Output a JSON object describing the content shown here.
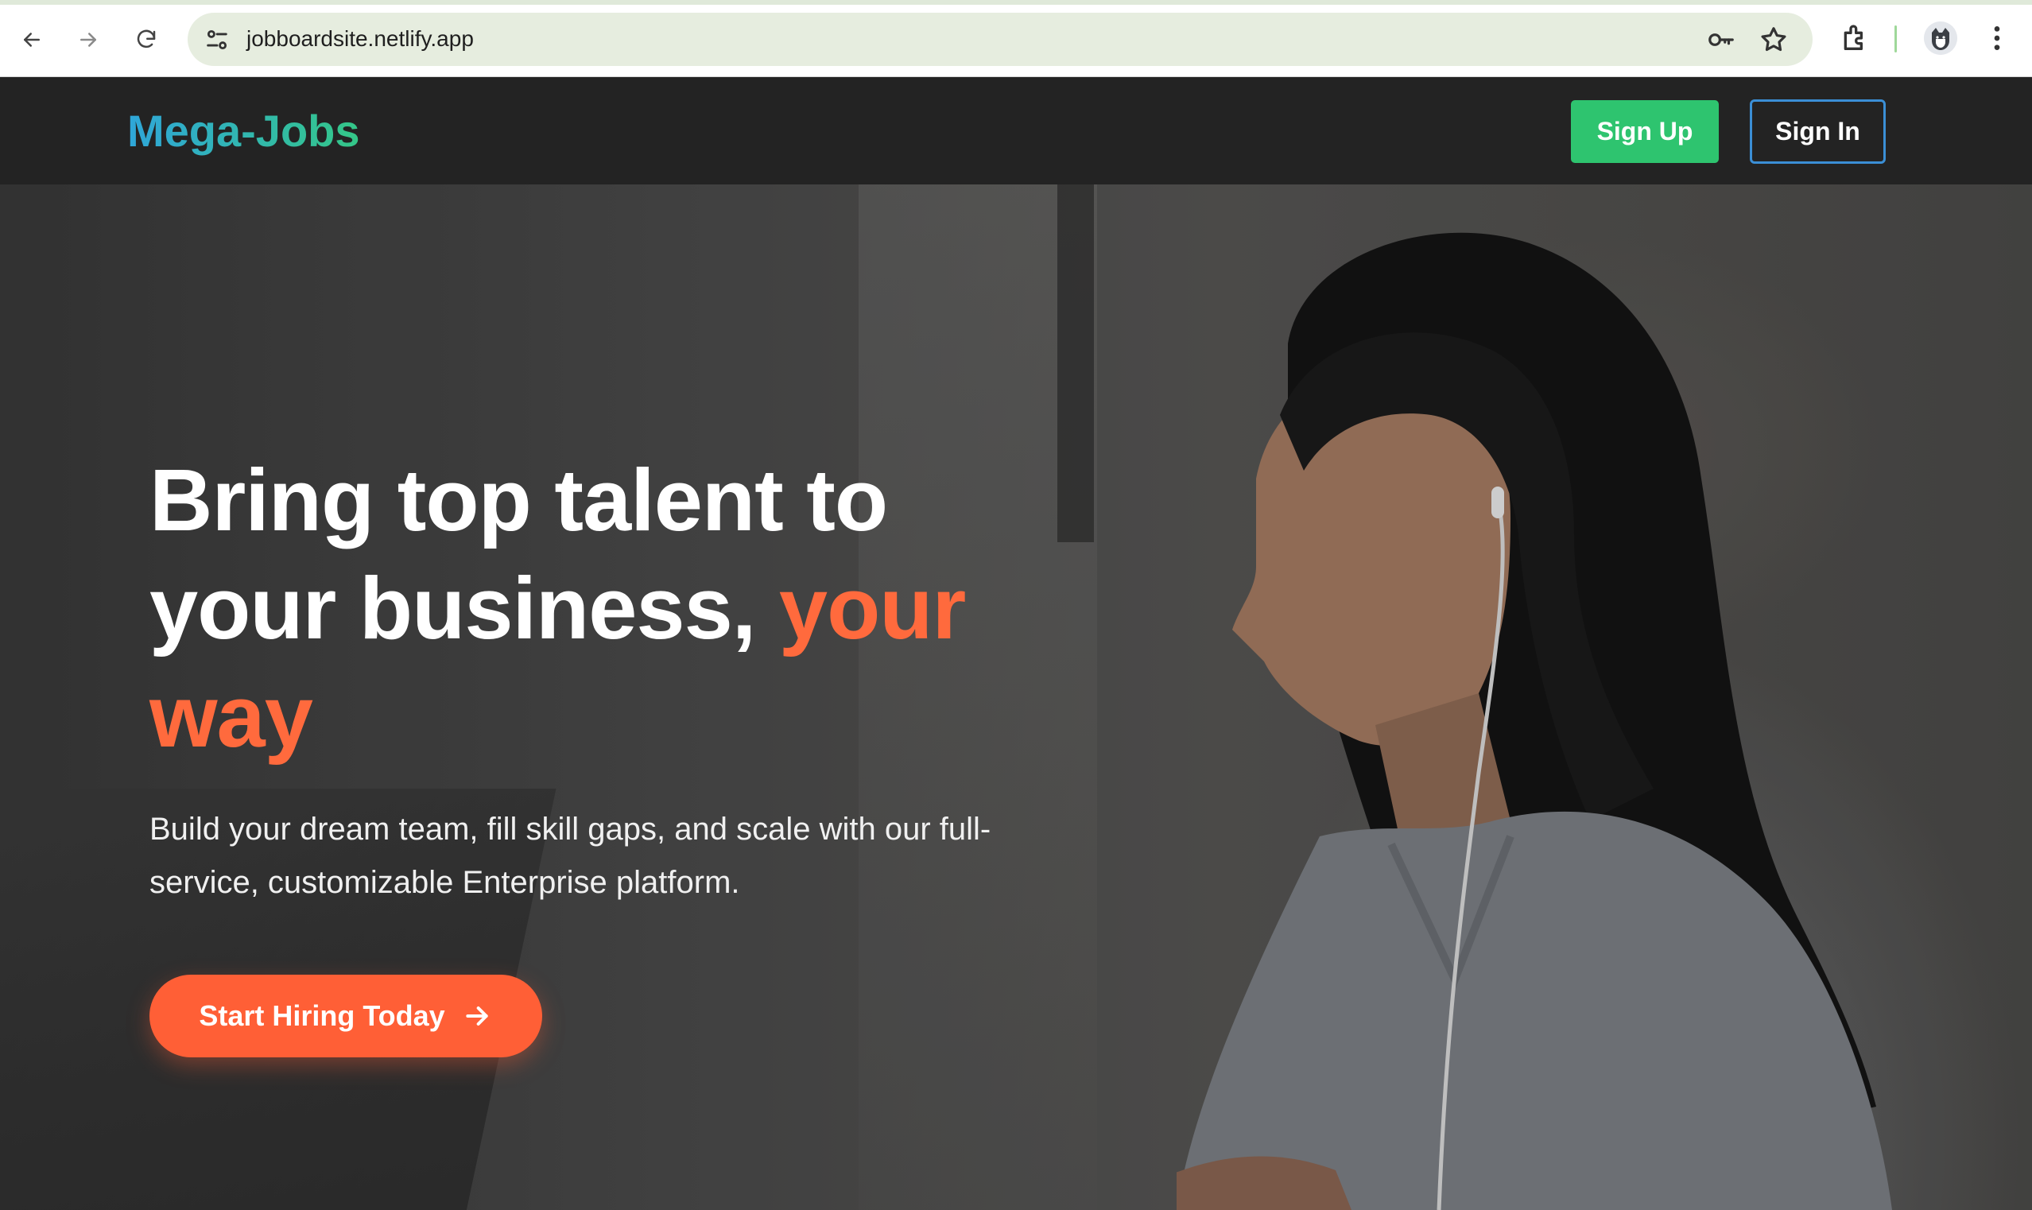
{
  "browser": {
    "url": "jobboardsite.netlify.app",
    "icons": [
      "back-arrow-icon",
      "forward-arrow-icon",
      "reload-icon",
      "site-settings-icon",
      "password-key-icon",
      "bookmark-star-icon",
      "extensions-icon",
      "profile-avatar-icon",
      "menu-kebab-icon"
    ]
  },
  "header": {
    "logo": "Mega-Jobs",
    "sign_up": "Sign Up",
    "sign_in": "Sign In",
    "colors": {
      "logo_start": "#2fa6d9",
      "logo_end": "#34c787",
      "sign_up_bg": "#2ec46f",
      "sign_in_border": "#3b8fd6"
    }
  },
  "hero": {
    "headline_part1": "Bring top talent to your business,",
    "headline_accent": "your way",
    "subtext": "Build your dream team, fill skill gaps, and scale with our full-service, customizable Enterprise platform.",
    "cta_label": "Start Hiring Today",
    "cta_icon": "arrow-right-icon",
    "colors": {
      "accent": "#ff6a3d",
      "cta_bg": "#ff5f36"
    }
  }
}
